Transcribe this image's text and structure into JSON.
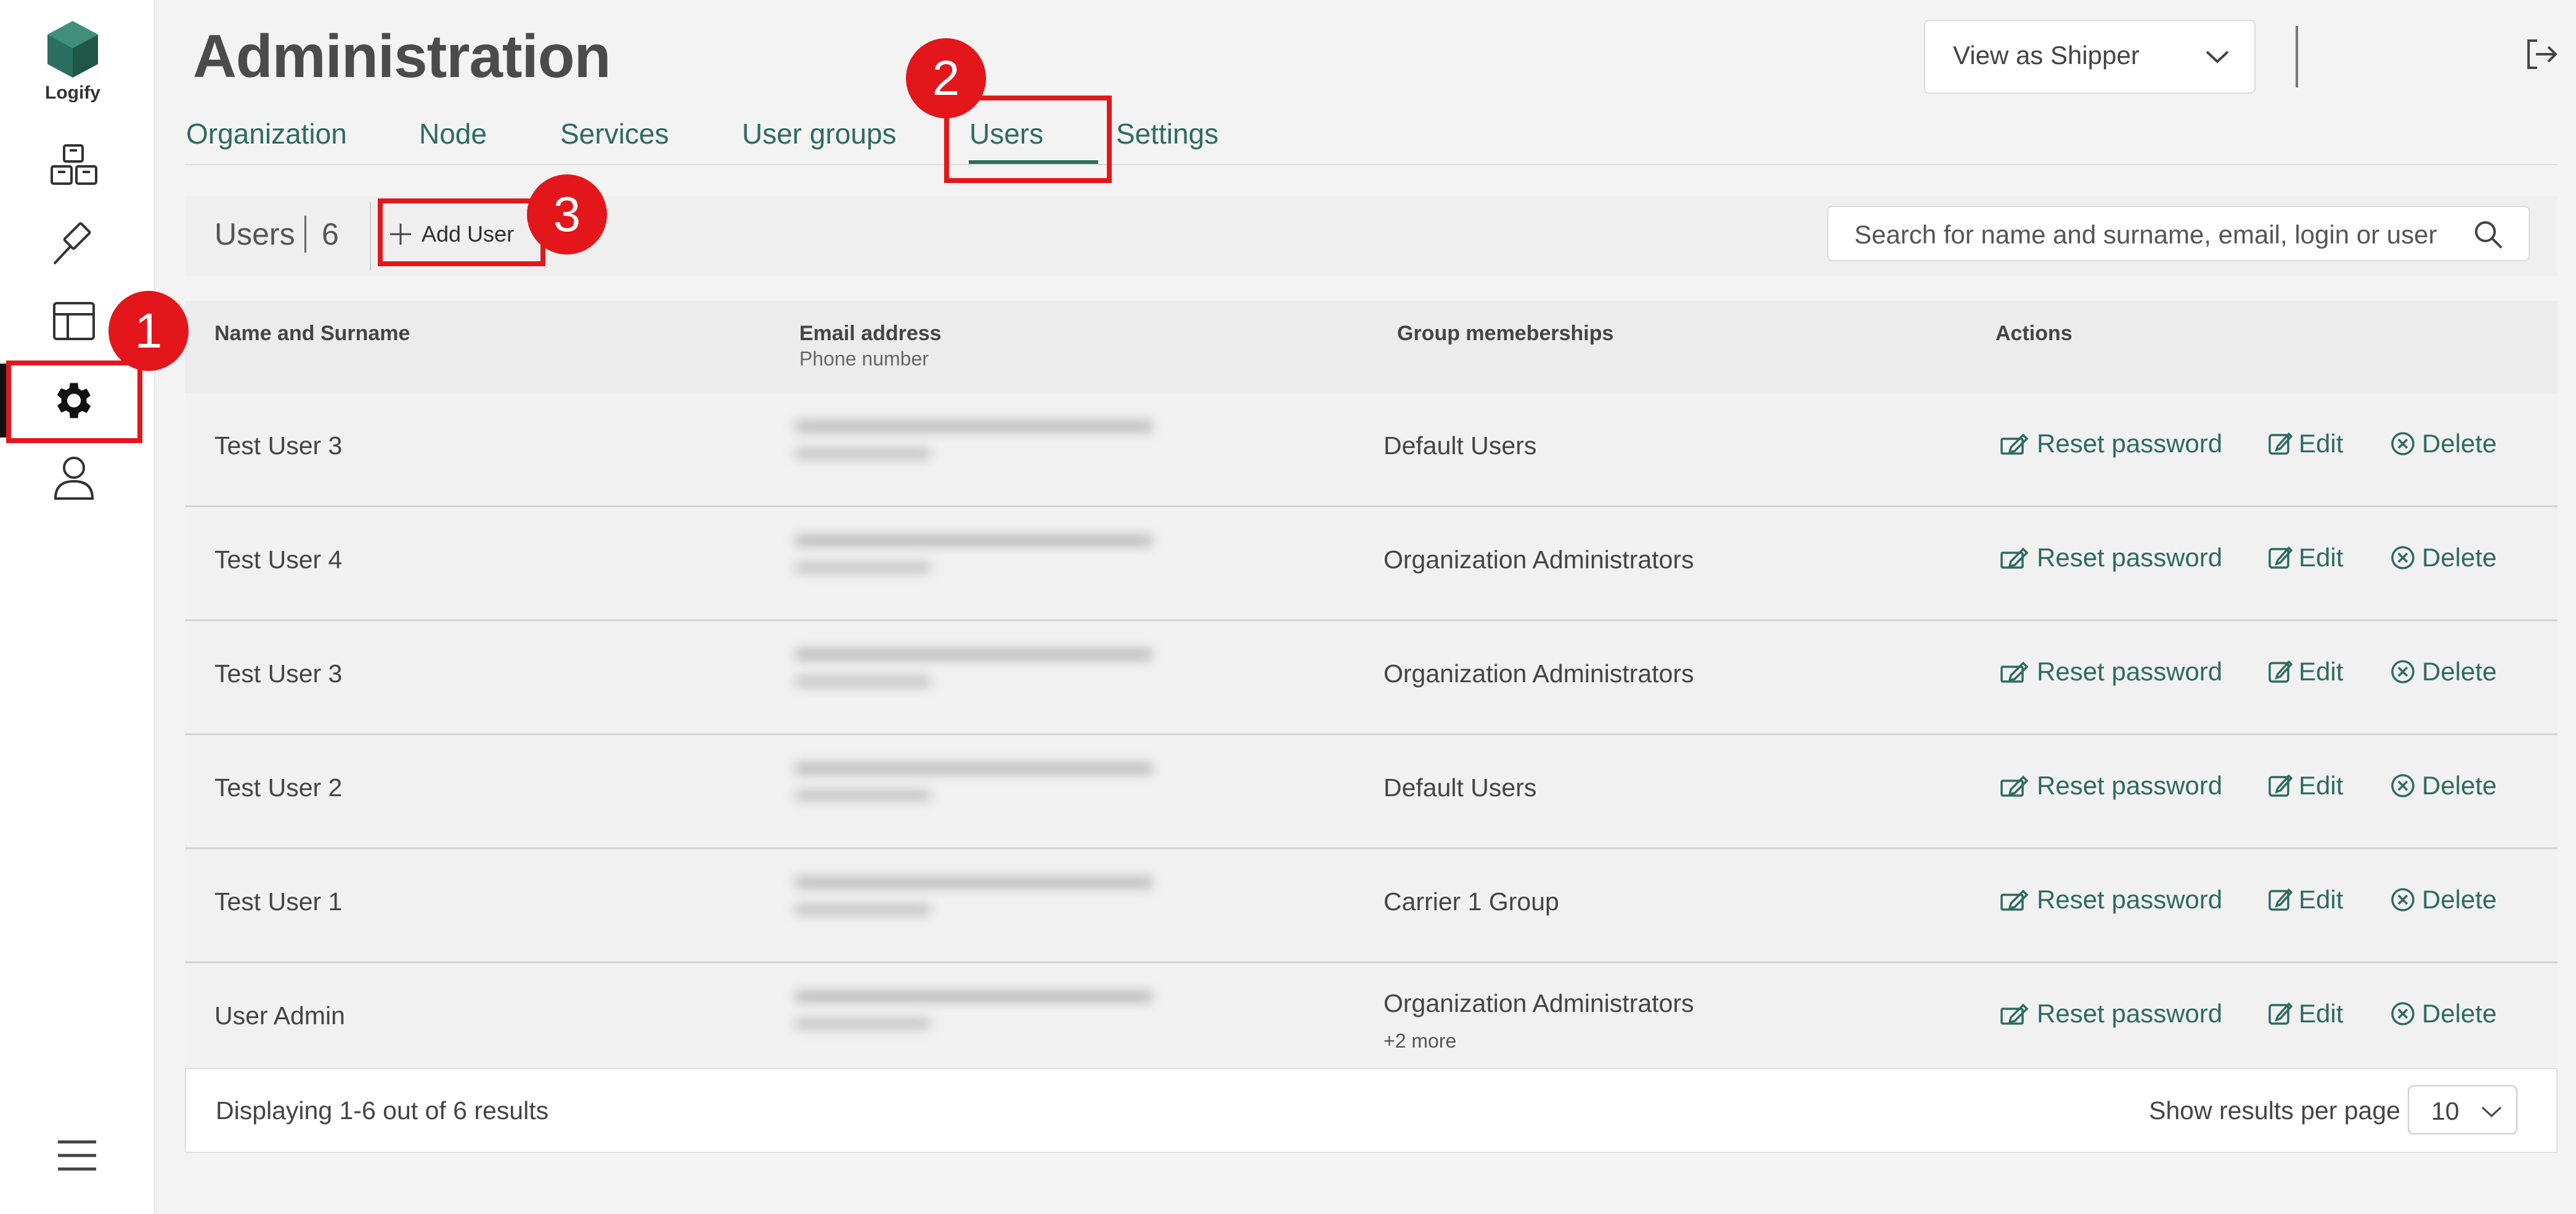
{
  "app": {
    "brand": "Logify",
    "accent_color": "#2e6b5e",
    "highlight_color": "#e3161b"
  },
  "sidebar": {
    "items": [
      {
        "icon": "boxes-icon"
      },
      {
        "icon": "hammer-icon"
      },
      {
        "icon": "layout-icon"
      },
      {
        "icon": "gear-icon",
        "active": true
      },
      {
        "icon": "user-icon"
      }
    ],
    "menu_icon": "hamburger-icon"
  },
  "header": {
    "title": "Administration",
    "view_select": {
      "value": "View as Shipper"
    }
  },
  "tabs": [
    {
      "label": "Organization"
    },
    {
      "label": "Node"
    },
    {
      "label": "Services"
    },
    {
      "label": "User groups"
    },
    {
      "label": "Users",
      "active": true
    },
    {
      "label": "Settings"
    }
  ],
  "toolbar": {
    "title": "Users",
    "count": "6",
    "add_label": "Add User",
    "search_placeholder": "Search for name and surname, email, login or user ID"
  },
  "table": {
    "columns": {
      "name": "Name and Surname",
      "email": "Email address",
      "phone": "Phone number",
      "groups": "Group memeberships",
      "actions": "Actions"
    },
    "action_labels": {
      "reset": "Reset password",
      "edit": "Edit",
      "delete": "Delete"
    },
    "rows": [
      {
        "name": "Test User 3",
        "group": "Default Users",
        "more": ""
      },
      {
        "name": "Test User 4",
        "group": "Organization Administrators",
        "more": ""
      },
      {
        "name": "Test User 3",
        "group": "Organization Administrators",
        "more": ""
      },
      {
        "name": "Test User 2",
        "group": "Default Users",
        "more": ""
      },
      {
        "name": "Test User 1",
        "group": "Carrier 1 Group",
        "more": ""
      },
      {
        "name": "User Admin",
        "group": "Organization Administrators",
        "more": "+2 more"
      }
    ]
  },
  "footer": {
    "displaying": "Displaying 1-6 out of 6 results",
    "per_page_label": "Show results per page",
    "per_page_value": "10"
  },
  "annotations": {
    "step1": "1",
    "step2": "2",
    "step3": "3"
  }
}
